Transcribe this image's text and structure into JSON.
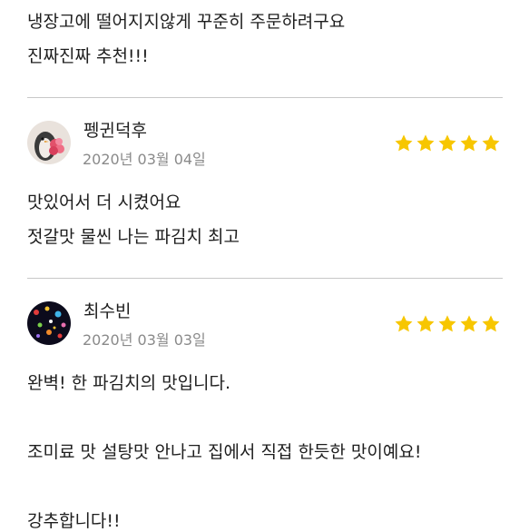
{
  "colors": {
    "star": "#f7c600",
    "divider": "#c8c8c8",
    "text": "#1e1e1e",
    "date": "#8a8a8a"
  },
  "top_review": {
    "lines": [
      "냉장고에 떨어지지않게 꾸준히 주문하려구요",
      "진짜진짜 추천!!!"
    ]
  },
  "reviews": [
    {
      "name": "펭귄덕후",
      "date": "2020년 03월 04일",
      "rating": 5,
      "avatar_icon": "penguin-with-flowers-avatar",
      "lines": [
        "맛있어서 더 시켰어요",
        "젓갈맛 물씬 나는 파김치 최고"
      ]
    },
    {
      "name": "최수빈",
      "date": "2020년 03월 03일",
      "rating": 5,
      "avatar_icon": "galaxy-dots-avatar",
      "lines": [
        "완벽! 한 파김치의 맛입니다.",
        "",
        "조미료 맛 설탕맛 안나고 집에서 직접 한듯한 맛이예요!",
        "",
        "강추합니다!!"
      ]
    }
  ]
}
